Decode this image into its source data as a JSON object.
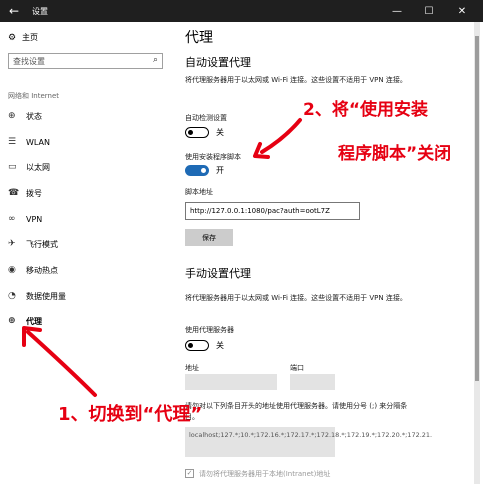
{
  "window": {
    "title": "设置",
    "back_glyph": "←",
    "min_glyph": "—",
    "max_glyph": "☐",
    "close_glyph": "✕"
  },
  "sidebar": {
    "home_label": "主页",
    "search_placeholder": "查找设置",
    "group_label": "网络和 Internet",
    "items": [
      {
        "label": "状态",
        "icon": "globe-icon"
      },
      {
        "label": "WLAN",
        "icon": "wifi-icon"
      },
      {
        "label": "以太网",
        "icon": "ethernet-icon"
      },
      {
        "label": "拨号",
        "icon": "phone-icon"
      },
      {
        "label": "VPN",
        "icon": "vpn-icon"
      },
      {
        "label": "飞行模式",
        "icon": "airplane-icon"
      },
      {
        "label": "移动热点",
        "icon": "hotspot-icon"
      },
      {
        "label": "数据使用量",
        "icon": "data-usage-icon"
      },
      {
        "label": "代理",
        "icon": "globe-icon"
      }
    ]
  },
  "main": {
    "page_title": "代理",
    "auto": {
      "title": "自动设置代理",
      "desc": "将代理服务器用于以太网或 Wi-Fi 连接。这些设置不适用于 VPN 连接。",
      "detect_label": "自动检测设置",
      "detect_state": "关",
      "script_label": "使用安装程序脚本",
      "script_state": "开",
      "address_label": "脚本地址",
      "address_value": "http://127.0.0.1:1080/pac?auth=ootL7Z",
      "save_label": "保存"
    },
    "manual": {
      "title": "手动设置代理",
      "desc": "将代理服务器用于以太网或 Wi-Fi 连接。这些设置不适用于 VPN 连接。",
      "use_proxy_label": "使用代理服务器",
      "use_proxy_state": "关",
      "address_label": "地址",
      "port_label": "端口",
      "exceptions_desc": "请勿对以下列条目开头的地址使用代理服务器。请使用分号 (;) 来分隔条目。",
      "exceptions_value": "localhost;127.*;10.*;172.16.*;172.17.*;172.18.*;172.19.*;172.20.*;172.21.",
      "bypass_local_label": "请勿将代理服务器用于本地(Intranet)地址"
    }
  },
  "annotations": {
    "step2_line1": "2、将“使用安装",
    "step2_line2": "程序脚本”关闭",
    "step1": "1、切换到“代理”"
  },
  "colors": {
    "titlebar": "#1f1f1f",
    "accent": "#1e6ab5",
    "annotation": "#e60012"
  }
}
